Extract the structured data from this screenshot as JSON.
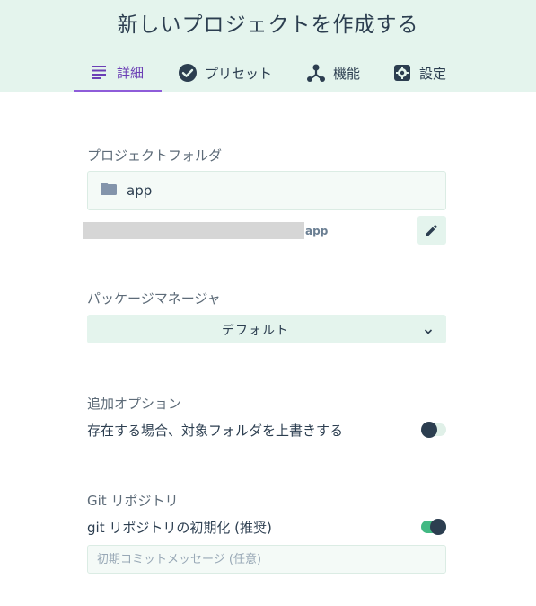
{
  "header": {
    "title": "新しいプロジェクトを作成する",
    "tabs": [
      {
        "label": "詳細",
        "icon": "subject-icon",
        "active": true
      },
      {
        "label": "プリセット",
        "icon": "check-circle-icon",
        "active": false
      },
      {
        "label": "機能",
        "icon": "device-hub-icon",
        "active": false
      },
      {
        "label": "設定",
        "icon": "settings-icon",
        "active": false
      }
    ]
  },
  "folder": {
    "label": "プロジェクトフォルダ",
    "value": "app",
    "path_suffix": "app"
  },
  "package_manager": {
    "label": "パッケージマネージャ",
    "selected": "デフォルト"
  },
  "options": {
    "label": "追加オプション",
    "overwrite_label": "存在する場合、対象フォルダを上書きする",
    "overwrite_enabled": false
  },
  "git": {
    "label": "Git リポジトリ",
    "init_label": "git リポジトリの初期化 (推奨)",
    "init_enabled": true,
    "commit_placeholder": "初期コミットメッセージ (任意)"
  },
  "colors": {
    "header_bg": "#e4f4ed",
    "active_tab": "#6b3fb5",
    "toggle_on": "#42b983",
    "text": "#2c3e50"
  }
}
